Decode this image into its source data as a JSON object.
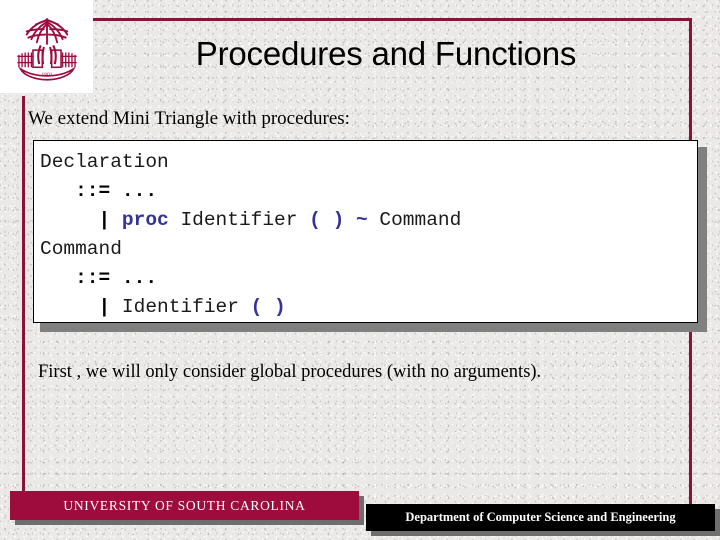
{
  "slide": {
    "title": "Procedures and Functions",
    "intro": "We extend Mini Triangle with procedures:",
    "closing": "First , we will only consider global procedures (with no arguments)."
  },
  "logo": {
    "name": "usc-palmetto-tree-logo",
    "color": "#9e0b3d",
    "motto": "1801"
  },
  "code": {
    "line1_lhs": "Declaration",
    "line2_op": "::=",
    "line2_rhs": "...",
    "line3_bar": "|",
    "line3_kw": "proc",
    "line3_name": "Identifier",
    "line3_parens": "( )",
    "line3_tilde": "~",
    "line3_tail": "Command",
    "line4_lhs": "Command",
    "line5_op": "::=",
    "line5_rhs": "...",
    "line6_bar": "|",
    "line6_name": "Identifier",
    "line6_parens": "( )"
  },
  "footer": {
    "university": "UNIVERSITY OF SOUTH CAROLINA",
    "department": "Department of Computer Science and Engineering"
  },
  "colors": {
    "maroon": "#8c1239",
    "usc_crimson": "#9e0b3d",
    "code_keyword_blue": "#333399",
    "background": "#ebe9e7"
  }
}
